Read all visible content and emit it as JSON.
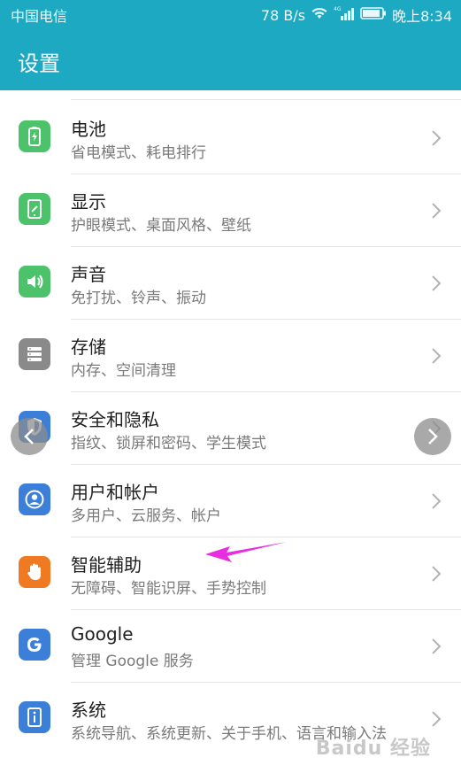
{
  "status_bar": {
    "carrier": "中国电信",
    "speed": "78 B/s",
    "network_label": "4G",
    "time": "晚上8:34"
  },
  "toolbar": {
    "title": "设置"
  },
  "items": [
    {
      "title": "电池",
      "subtitle": "省电模式、耗电排行",
      "icon": "battery-icon",
      "color": "#4cc36a"
    },
    {
      "title": "显示",
      "subtitle": "护眼模式、桌面风格、壁纸",
      "icon": "display-icon",
      "color": "#4cc36a"
    },
    {
      "title": "声音",
      "subtitle": "免打扰、铃声、振动",
      "icon": "speaker-icon",
      "color": "#4cc36a"
    },
    {
      "title": "存储",
      "subtitle": "内存、空间清理",
      "icon": "storage-icon",
      "color": "#8a8a8a"
    },
    {
      "title": "安全和隐私",
      "subtitle": "指纹、锁屏和密码、学生模式",
      "icon": "shield-icon",
      "color": "#3b7fd9"
    },
    {
      "title": "用户和帐户",
      "subtitle": "多用户、云服务、帐户",
      "icon": "user-icon",
      "color": "#3b7fd9"
    },
    {
      "title": "智能辅助",
      "subtitle": "无障碍、智能识屏、手势控制",
      "icon": "hand-icon",
      "color": "#f07a22"
    },
    {
      "title": "Google",
      "subtitle": "管理 Google 服务",
      "icon": "google-icon",
      "color": "#3b7fd9"
    },
    {
      "title": "系统",
      "subtitle": "系统导航、系统更新、关于手机、语言和输入法",
      "icon": "info-icon",
      "color": "#3b7fd9"
    }
  ],
  "colors": {
    "accent": "#1ea9c3",
    "annotation": "#e62ee0"
  },
  "watermark": "Baidu 经验"
}
